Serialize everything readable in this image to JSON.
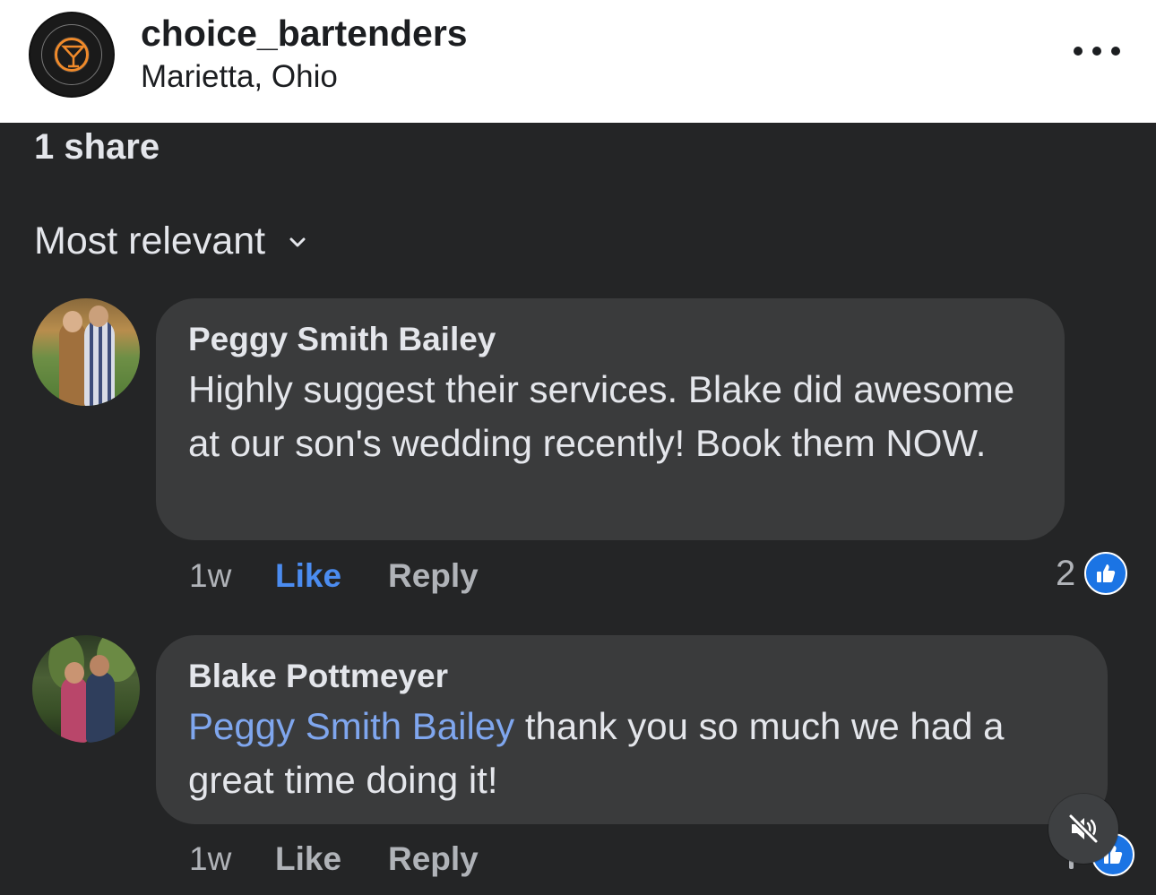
{
  "header": {
    "account_name": "choice_bartenders",
    "location": "Marietta, Ohio",
    "more_icon": "more-horizontal-icon"
  },
  "post": {
    "shares": "1 share",
    "sort_label": "Most relevant"
  },
  "comments": [
    {
      "author": "Peggy Smith Bailey",
      "text": "Highly suggest their services. Blake did awesome at our son's wedding recently! Book them NOW.",
      "time": "1w",
      "like_label": "Like",
      "like_active": true,
      "reply_label": "Reply",
      "reaction_count": "2"
    },
    {
      "author": "Blake Pottmeyer",
      "mention": "Peggy Smith Bailey",
      "text": " thank you so much we had a great time doing it!",
      "time": "1w",
      "like_label": "Like",
      "like_active": false,
      "reply_label": "Reply"
    }
  ],
  "colors": {
    "background": "#242526",
    "bubble": "#3a3b3c",
    "accent_blue": "#1b74e4",
    "like_active": "#4b8cf0",
    "mention": "#7fa6ee"
  },
  "icons": [
    "logo-icon",
    "chevron-down-icon",
    "like-reaction-icon",
    "mute-icon"
  ]
}
